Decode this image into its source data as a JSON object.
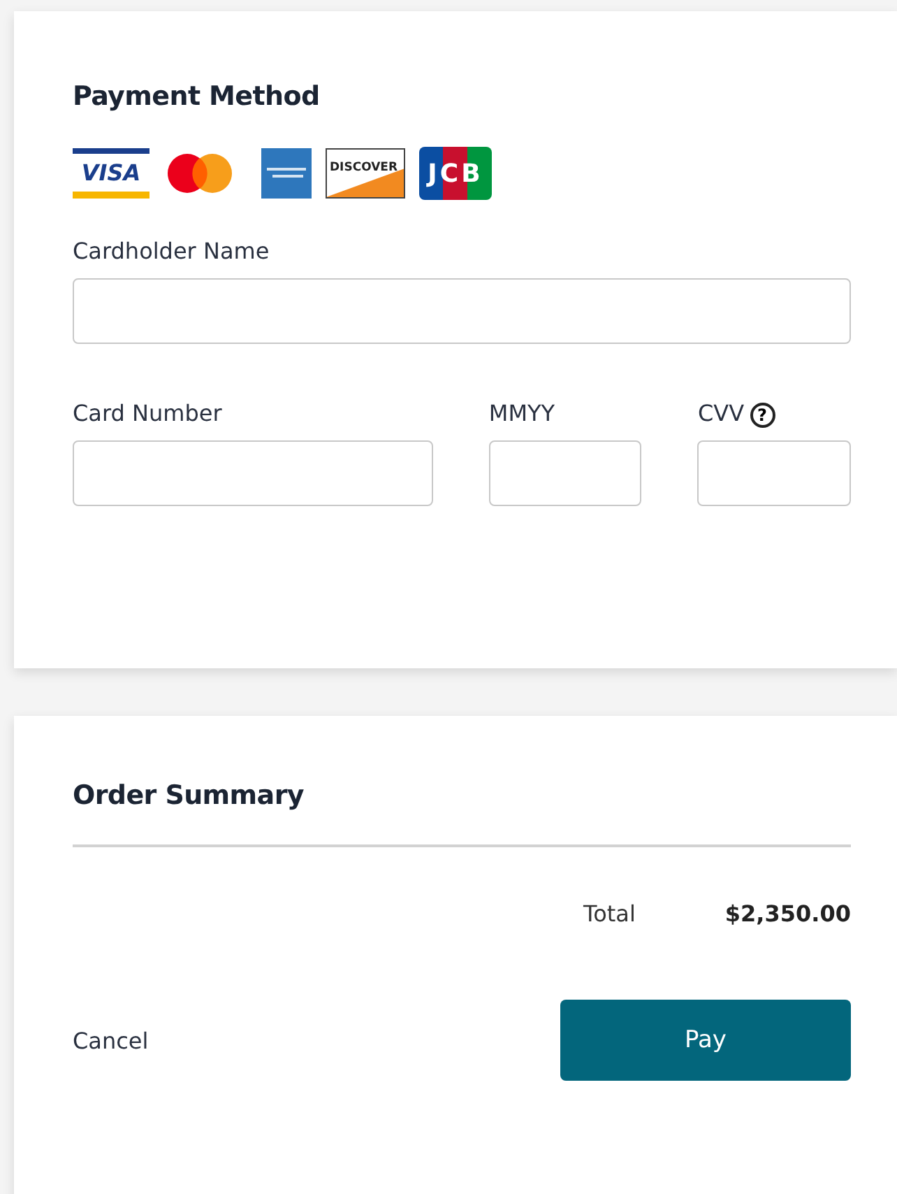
{
  "payment_method": {
    "title": "Payment Method",
    "card_logos": [
      {
        "kind": "visa",
        "text": "VISA"
      },
      {
        "kind": "mastercard"
      },
      {
        "kind": "amex"
      },
      {
        "kind": "discover",
        "text": "DISCOVER"
      },
      {
        "kind": "jcb",
        "text": "JCB"
      }
    ],
    "cardholder_name": {
      "label": "Cardholder Name"
    },
    "card_number": {
      "label": "Card Number"
    },
    "expiry": {
      "label": "MMYY"
    },
    "cvv": {
      "label": "CVV",
      "help_icon": "?"
    }
  },
  "order_summary": {
    "title": "Order Summary",
    "total_label": "Total",
    "total_value": "$2,350.00"
  },
  "buttons": {
    "cancel": "Cancel",
    "pay": "Pay"
  }
}
